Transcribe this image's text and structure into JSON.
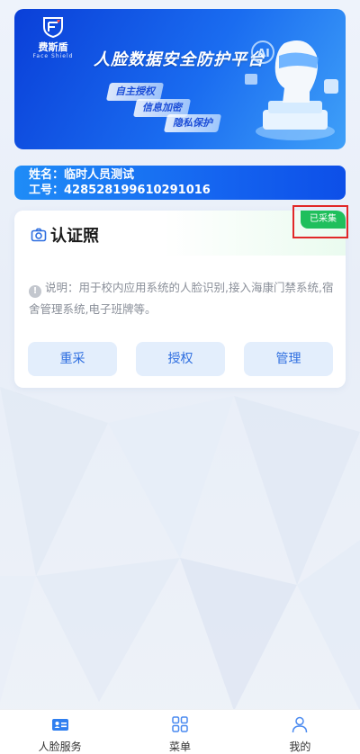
{
  "banner": {
    "logo_cn": "费斯盾",
    "logo_en": "Face Shield",
    "title": "人脸数据安全防护平台",
    "tags": [
      "自主授权",
      "信息加密",
      "隐私保护"
    ]
  },
  "user": {
    "name_label": "姓名：",
    "name_value": "临时人员测试",
    "id_label": "工号：",
    "id_value": "428528199610291016"
  },
  "cert": {
    "title": "认证照",
    "status_badge": "已采集",
    "description": "说明：用于校内应用系统的人脸识别,接入海康门禁系统,宿舍管理系统,电子班牌等。",
    "buttons": [
      "重采",
      "授权",
      "管理"
    ]
  },
  "tabbar": {
    "items": [
      "人脸服务",
      "菜单",
      "我的"
    ]
  },
  "colors": {
    "primary": "#1565f0",
    "badge_green": "#1fbf5c",
    "button_bg": "#e3eefc",
    "button_text": "#2f6fe0"
  },
  "icons": [
    "camera-icon",
    "info-icon",
    "id-card-icon",
    "grid-icon",
    "person-icon"
  ]
}
